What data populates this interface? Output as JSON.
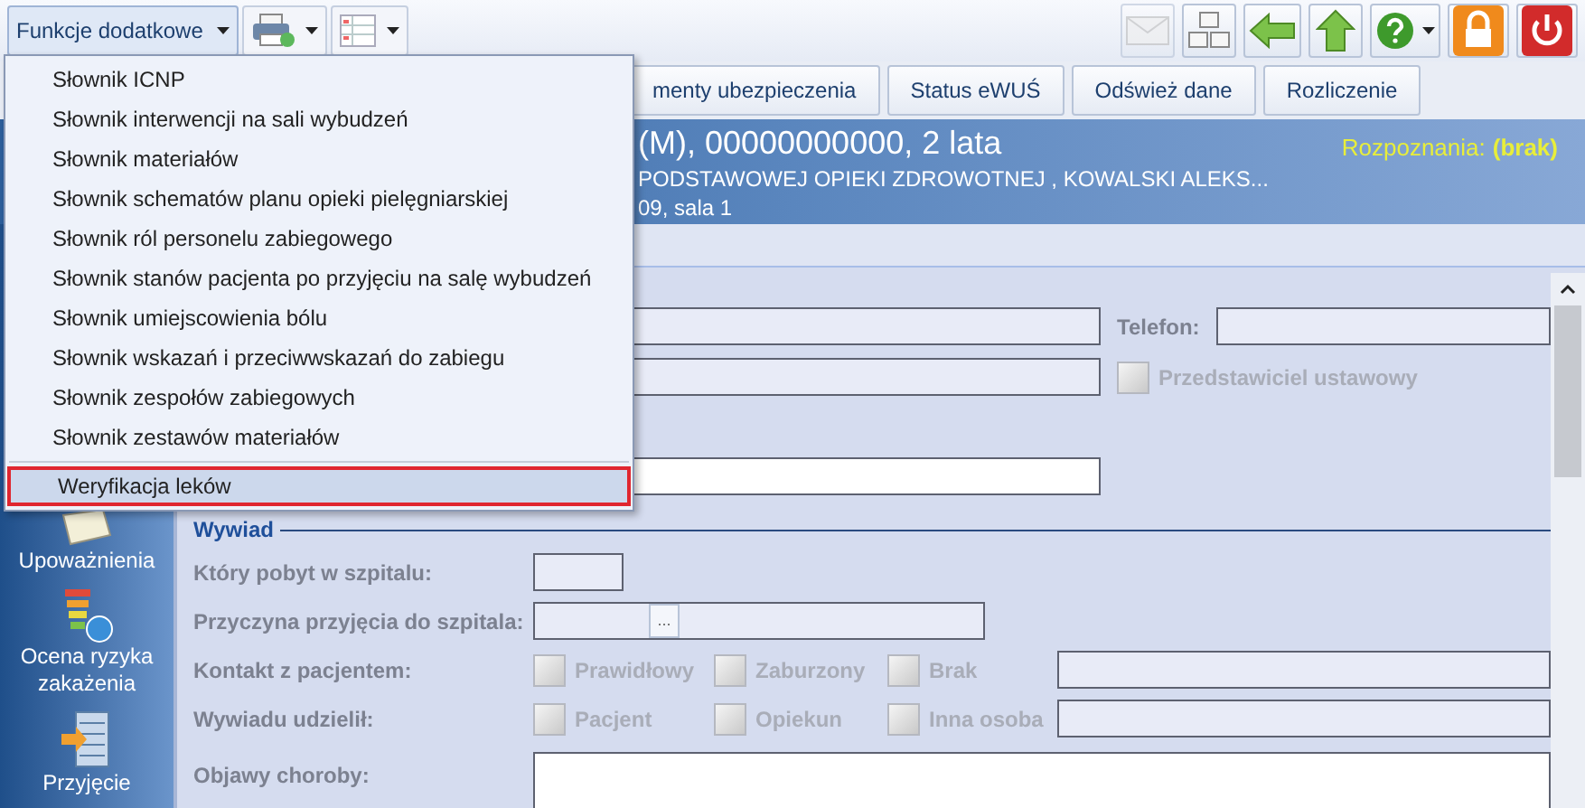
{
  "toolbar": {
    "menu_button": {
      "label": "Funkcje dodatkowe",
      "expanded": true
    },
    "left_buttons": [
      {
        "kind": "print"
      },
      {
        "kind": "layout"
      }
    ],
    "right_buttons": [
      {
        "kind": "mail",
        "disabled": true
      },
      {
        "kind": "computers",
        "disabled": false
      },
      {
        "kind": "back",
        "disabled": false
      },
      {
        "kind": "up",
        "disabled": false
      },
      {
        "kind": "help",
        "disabled": false
      },
      {
        "kind": "lock",
        "disabled": false
      },
      {
        "kind": "power",
        "disabled": false
      }
    ]
  },
  "menu": {
    "groups": [
      [
        {
          "label": "Słownik ICNP",
          "selected": false
        },
        {
          "label": "Słownik interwencji na sali wybudzeń",
          "selected": false
        },
        {
          "label": "Słownik materiałów",
          "selected": false
        },
        {
          "label": "Słownik schematów planu opieki pielęgniarskiej",
          "selected": false
        },
        {
          "label": "Słownik ról personelu zabiegowego",
          "selected": false
        },
        {
          "label": "Słownik stanów pacjenta po przyjęciu na salę wybudzeń",
          "selected": false
        },
        {
          "label": "Słownik umiejscowienia bólu",
          "selected": false
        },
        {
          "label": "Słownik wskazań i przeciwwskazań do zabiegu",
          "selected": false
        },
        {
          "label": "Słownik zespołów zabiegowych",
          "selected": false
        },
        {
          "label": "Słownik zestawów materiałów",
          "selected": false
        }
      ],
      [
        {
          "label": "Weryfikacja leków",
          "selected": true
        }
      ]
    ]
  },
  "action_buttons": [
    "menty ubezpieczenia",
    "Status eWUŚ",
    "Odśwież dane",
    "Rozliczenie"
  ],
  "patient_header": {
    "line_1": "(M), 00000000000, 2 lata",
    "line_2": "PODSTAWOWEJ OPIEKI ZDROWOTNEJ , KOWALSKI ALEKS...",
    "line_3": "09, sala 1",
    "diagnosis_label": "Rozpoznania:",
    "diagnosis_value": "(brak)"
  },
  "sidebar": {
    "items": [
      {
        "label": "Upoważnienia",
        "kind": "document"
      },
      {
        "label": "Ocena ryzyka zakażenia",
        "kind": "risk"
      },
      {
        "label": "Przyjęcie",
        "kind": "building"
      }
    ]
  },
  "form": {
    "phone_label": "Telefon:",
    "legal_representative": {
      "label": "Przedstawiciel ustawowy",
      "checked": false,
      "disabled": true
    },
    "interview": {
      "title": "Wywiad",
      "stay_label": "Który pobyt w szpitalu:",
      "reason_label": "Przyczyna przyjęcia do szpitala:",
      "browse_button": "...",
      "contact": {
        "label": "Kontakt z pacjentem:",
        "options": [
          {
            "label": "Prawidłowy",
            "checked": false,
            "disabled": true
          },
          {
            "label": "Zaburzony",
            "checked": false,
            "disabled": true
          },
          {
            "label": "Brak",
            "checked": false,
            "disabled": true
          }
        ]
      },
      "informant": {
        "label": "Wywiadu udzielił:",
        "options": [
          {
            "label": "Pacjent",
            "checked": false,
            "disabled": true
          },
          {
            "label": "Opiekun",
            "checked": false,
            "disabled": true
          },
          {
            "label": "Inna osoba",
            "checked": false,
            "disabled": true
          }
        ]
      },
      "symptoms_label": "Objawy choroby:"
    }
  }
}
